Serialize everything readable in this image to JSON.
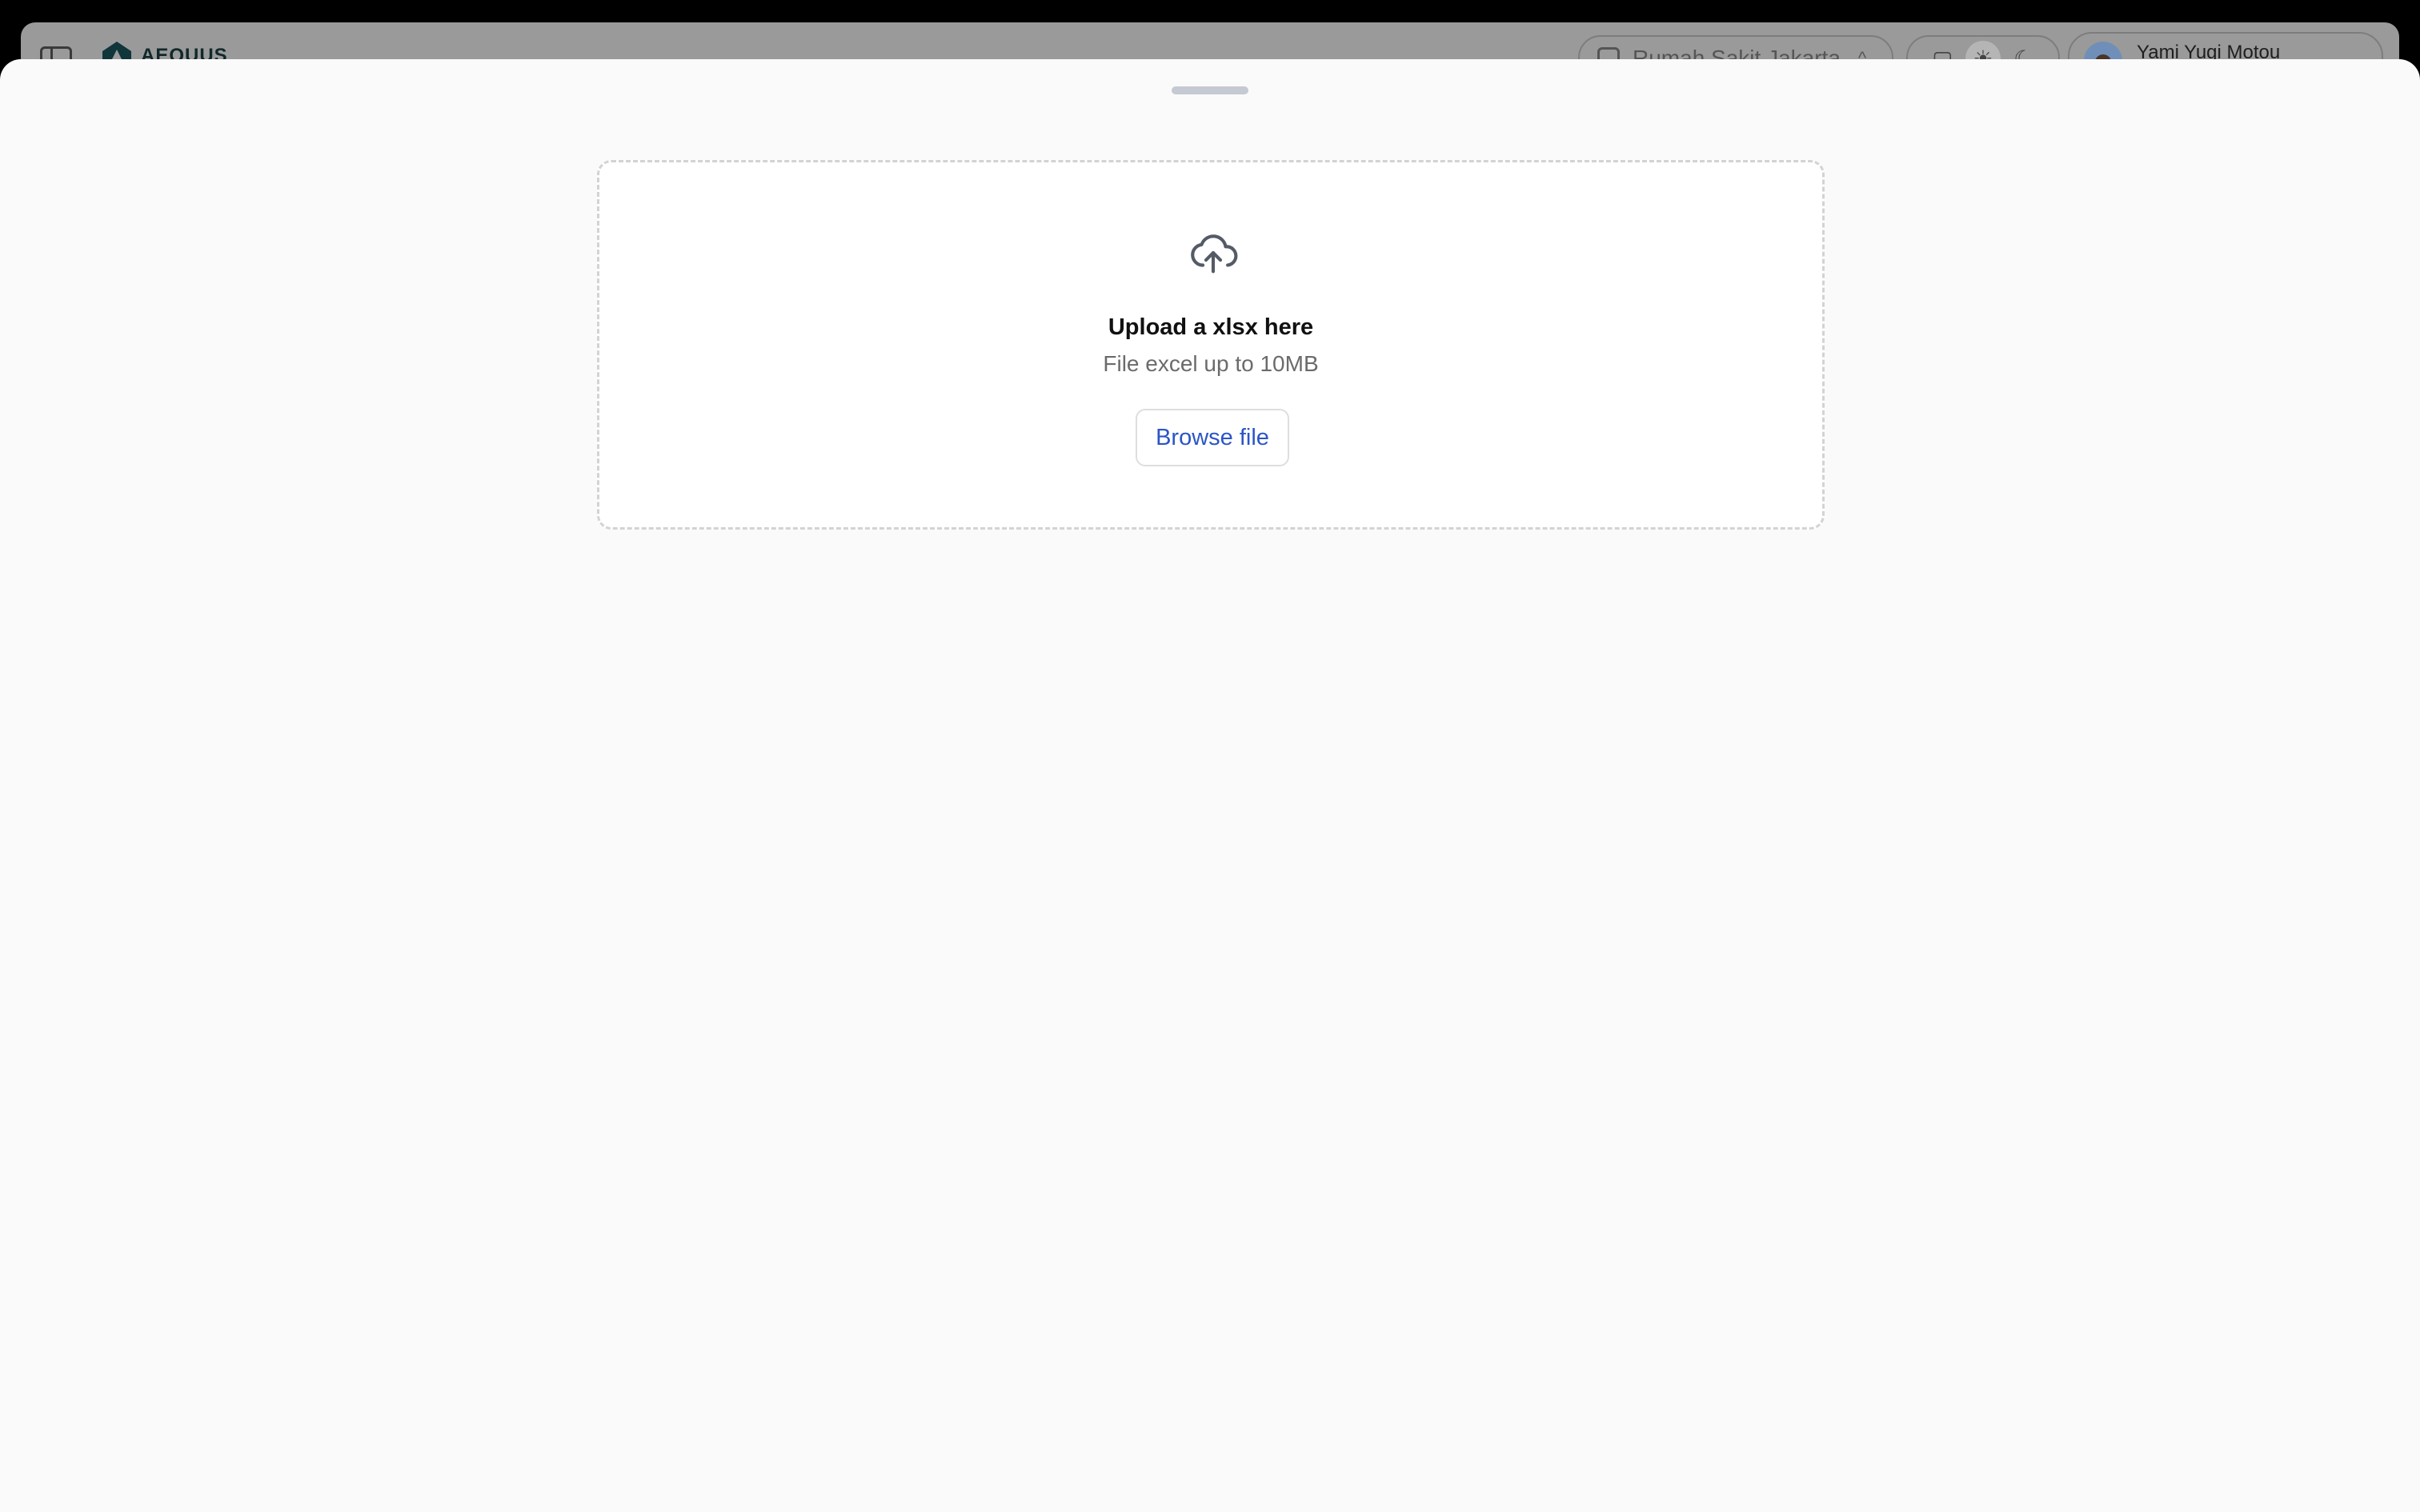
{
  "header": {
    "logo_text": "AEQUUS",
    "organization": "Rumah Sakit Jakarta",
    "user_name": "Yami Yugi Motou"
  },
  "upload": {
    "title": "Upload a xlsx here",
    "subtitle": "File excel up to 10MB",
    "browse_label": "Browse file"
  },
  "colors": {
    "accent": "#2b55c6",
    "sheet_bg": "#fafafa",
    "dropzone_border": "#d3d3d3"
  }
}
